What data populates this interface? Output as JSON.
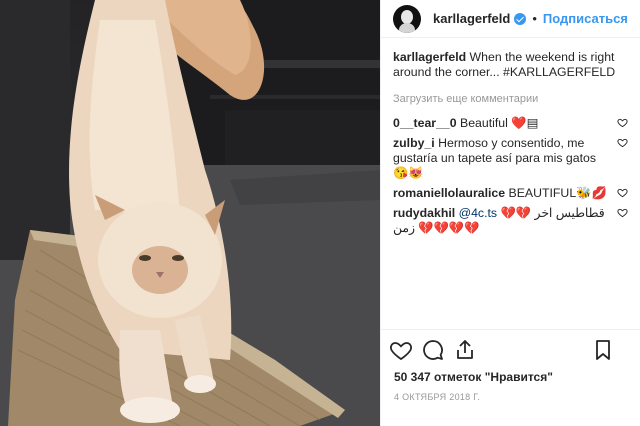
{
  "post": {
    "username": "karllagerfeld",
    "follow_label": "Подписаться",
    "dot": "•",
    "caption_user": "karllagerfeld",
    "caption_text": " When the weekend is right around the corner... #KARLLAGERFELD",
    "load_more": "Загрузить еще комментарии",
    "comments": [
      {
        "user": "0__tear__0",
        "text": " Beautiful ❤️▤"
      },
      {
        "user": "zulby_i",
        "text": " Hermoso y consentido, me gustaría un tapete así para mis gatos 😘😻"
      },
      {
        "user": "romaniellolauralice",
        "text": " BEAUTIFUL🐝💋"
      },
      {
        "user": "rudydakhil",
        "mention": " @4c.ts",
        "text": " 💔💔 قطاطيس اخر زمن 💔💔💔💔"
      }
    ],
    "likes_text": "50 347 отметок \"Нравится\"",
    "date_text": "4 ОКТЯБРЯ 2018 Г."
  },
  "colors": {
    "accent": "#3897f0",
    "text": "#262626",
    "muted": "#999999",
    "mention": "#003569"
  },
  "icons": [
    "verified-badge-icon",
    "like-icon",
    "comment-icon",
    "share-icon",
    "save-bookmark-icon",
    "heart-small-icon"
  ]
}
